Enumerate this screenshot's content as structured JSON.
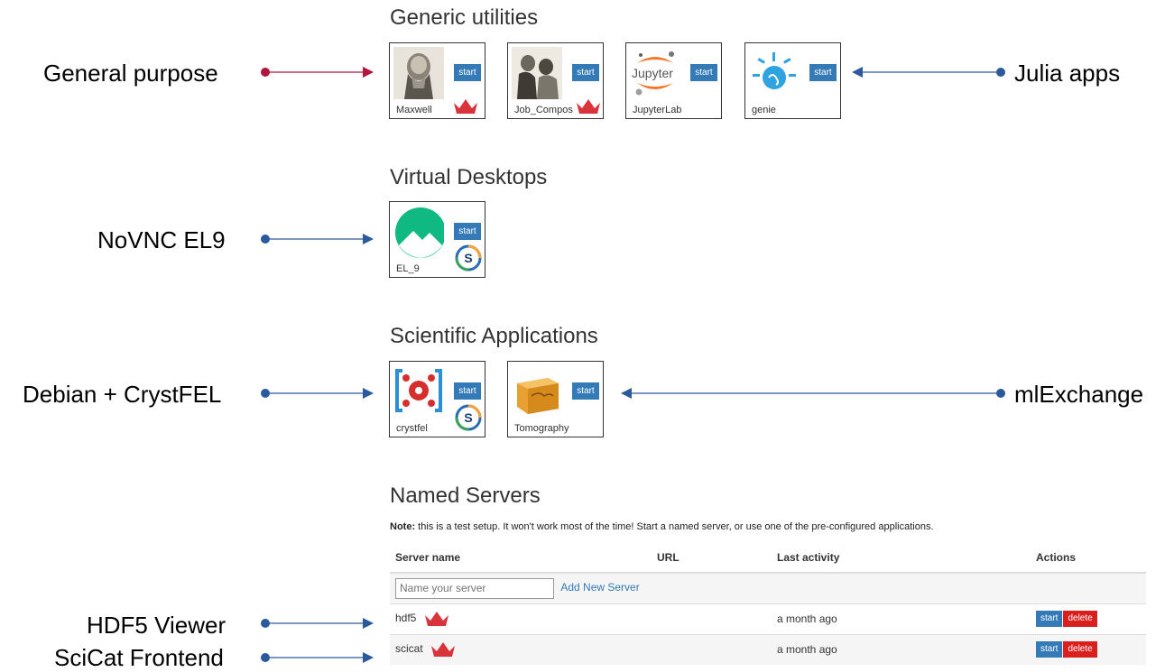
{
  "sections": {
    "generic": "Generic utilities",
    "virtual": "Virtual Desktops",
    "scientific": "Scientific Applications",
    "named": "Named Servers"
  },
  "tiles": {
    "maxwell": {
      "label": "Maxwell",
      "start": "start"
    },
    "job_composer": {
      "label": "Job_Compos",
      "start": "start"
    },
    "jupyterlab": {
      "label": "JupyterLab",
      "start": "start",
      "logo_text": "Jupyter"
    },
    "genie": {
      "label": "genie",
      "start": "start"
    },
    "el9": {
      "label": "EL_9",
      "start": "start"
    },
    "crystfel": {
      "label": "crystfel",
      "start": "start"
    },
    "tomography": {
      "label": "Tomography",
      "start": "start"
    }
  },
  "annotations": {
    "general_purpose": "General purpose",
    "julia_apps": "Julia apps",
    "novnc": "NoVNC EL9",
    "crystfel": "Debian + CrystFEL",
    "mlexchange": "mlExchange",
    "hdf5": "HDF5 Viewer",
    "scicat": "SciCat Frontend"
  },
  "named_servers": {
    "note_label": "Note:",
    "note_text": " this is a test setup. It won't work most of the time! Start a named server, or use one of the pre-configured applications.",
    "columns": [
      "Server name",
      "URL",
      "Last activity",
      "Actions"
    ],
    "input_placeholder": "Name your server",
    "add_label": "Add New Server",
    "rows": [
      {
        "name": "hdf5",
        "url": "",
        "last_activity": "a month ago",
        "start": "start",
        "delete": "delete"
      },
      {
        "name": "scicat",
        "url": "",
        "last_activity": "a month ago",
        "start": "start",
        "delete": "delete"
      }
    ]
  },
  "colors": {
    "start_button": "#337ab7",
    "delete_button": "#d9201e",
    "arrow_general": "#b0163f",
    "arrow_blue": "#2b5a9c",
    "crown": "#d9343b"
  }
}
